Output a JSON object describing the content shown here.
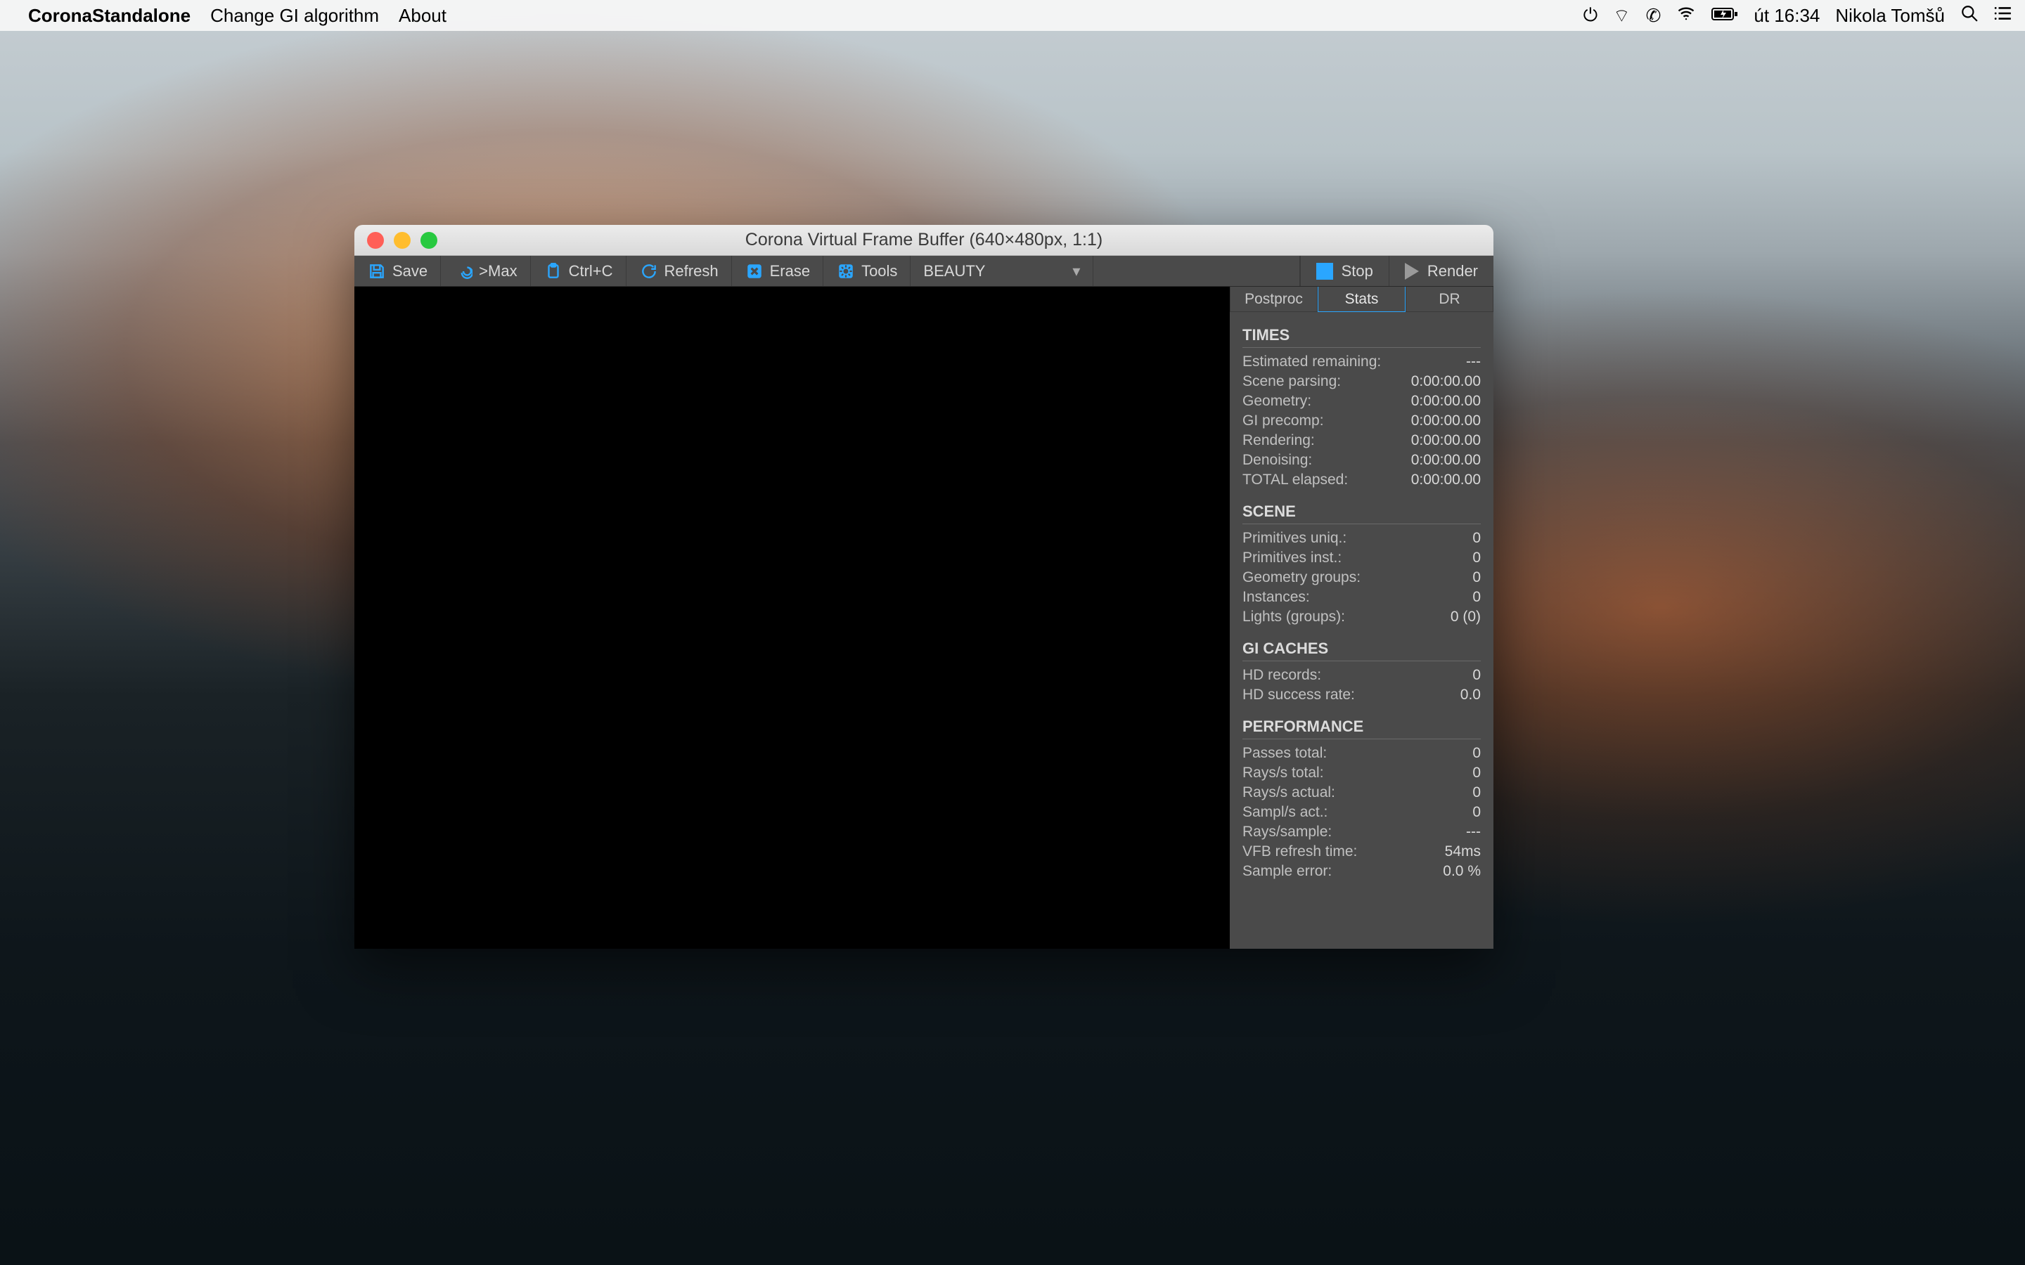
{
  "menubar": {
    "app_name": "CoronaStandalone",
    "items": [
      "Change GI algorithm",
      "About"
    ],
    "clock": "út 16:34",
    "user": "Nikola Tomšů"
  },
  "window": {
    "title": "Corona Virtual Frame Buffer (640×480px, 1:1)"
  },
  "toolbar": {
    "save": "Save",
    "tomax": ">Max",
    "copy": "Ctrl+C",
    "refresh": "Refresh",
    "erase": "Erase",
    "tools": "Tools",
    "pass": "BEAUTY",
    "stop": "Stop",
    "render": "Render"
  },
  "tabs": {
    "postproc": "Postproc",
    "stats": "Stats",
    "dr": "DR"
  },
  "stats": {
    "times": {
      "title": "TIMES",
      "rows": [
        {
          "label": "Estimated remaining:",
          "value": "---"
        },
        {
          "label": "Scene parsing:",
          "value": "0:00:00.00"
        },
        {
          "label": "Geometry:",
          "value": "0:00:00.00"
        },
        {
          "label": "GI precomp:",
          "value": "0:00:00.00"
        },
        {
          "label": "Rendering:",
          "value": "0:00:00.00"
        },
        {
          "label": "Denoising:",
          "value": "0:00:00.00"
        },
        {
          "label": "TOTAL elapsed:",
          "value": "0:00:00.00"
        }
      ]
    },
    "scene": {
      "title": "SCENE",
      "rows": [
        {
          "label": "Primitives uniq.:",
          "value": "0"
        },
        {
          "label": "Primitives inst.:",
          "value": "0"
        },
        {
          "label": "Geometry groups:",
          "value": "0"
        },
        {
          "label": "Instances:",
          "value": "0"
        },
        {
          "label": "Lights (groups):",
          "value": "0 (0)"
        }
      ]
    },
    "gicaches": {
      "title": "GI CACHES",
      "rows": [
        {
          "label": "HD records:",
          "value": "0"
        },
        {
          "label": "HD success rate:",
          "value": "0.0"
        }
      ]
    },
    "performance": {
      "title": "PERFORMANCE",
      "rows": [
        {
          "label": "Passes total:",
          "value": "0"
        },
        {
          "label": "Rays/s total:",
          "value": "0"
        },
        {
          "label": "Rays/s actual:",
          "value": "0"
        },
        {
          "label": "Sampl/s act.:",
          "value": "0"
        },
        {
          "label": "Rays/sample:",
          "value": "---"
        },
        {
          "label": "VFB refresh time:",
          "value": "54ms"
        },
        {
          "label": "Sample error:",
          "value": "0.0 %"
        }
      ]
    }
  }
}
